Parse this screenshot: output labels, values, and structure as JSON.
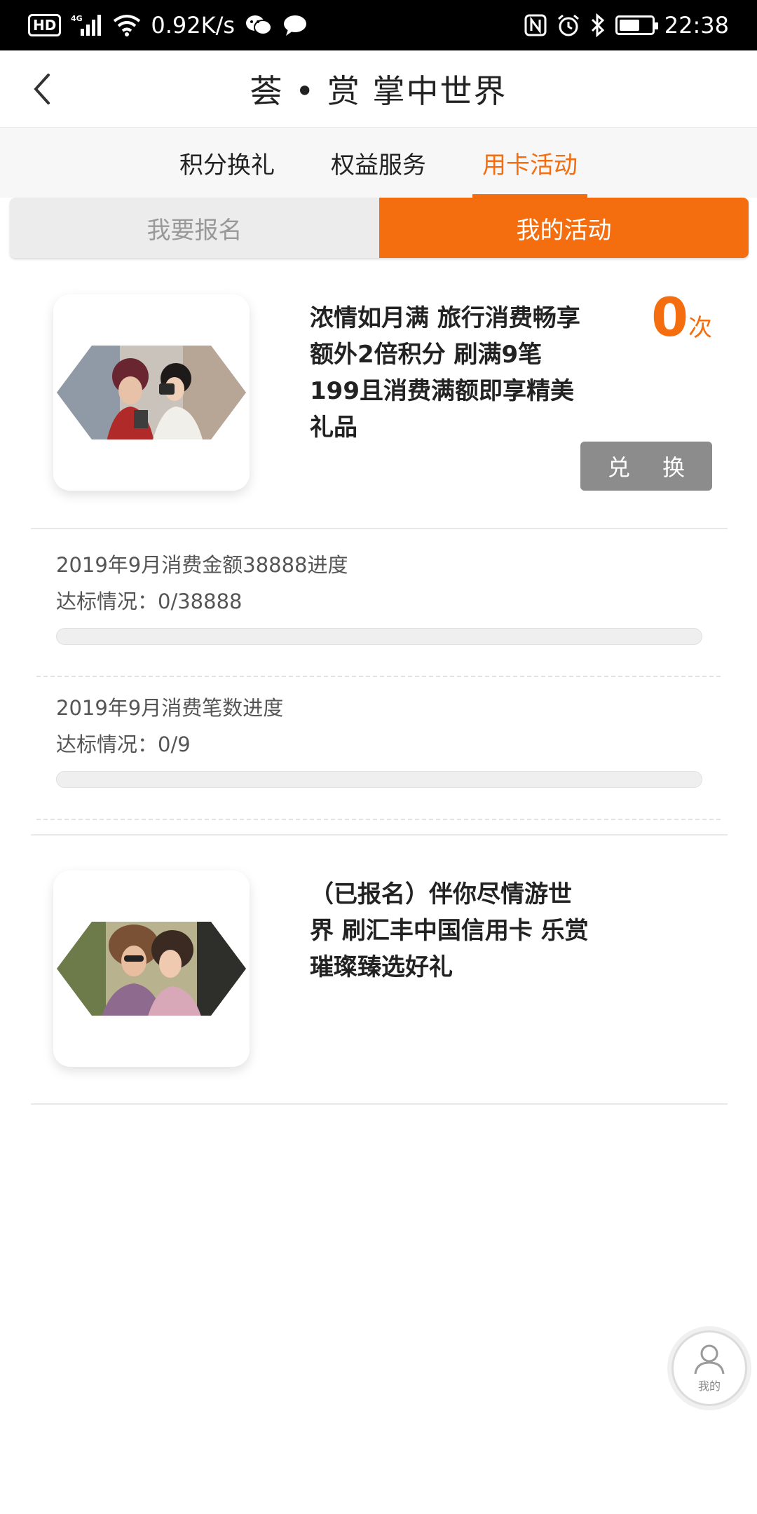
{
  "status_bar": {
    "hd": "HD",
    "network": "4G",
    "speed": "0.92K/s",
    "time": "22:38",
    "battery_level": 0.65
  },
  "header": {
    "title": "荟 • 赏 掌中世界"
  },
  "tabs": [
    {
      "label": "积分换礼",
      "active": false
    },
    {
      "label": "权益服务",
      "active": false
    },
    {
      "label": "用卡活动",
      "active": true
    }
  ],
  "segment": {
    "left": "我要报名",
    "right": "我的活动",
    "selected": "right"
  },
  "activities": [
    {
      "title": "浓情如月满 旅行消费畅享额外2倍积分 刷满9笔199且消费满额即享精美礼品",
      "count": "0",
      "count_unit": "次",
      "redeem_label": "兑 换",
      "progress": [
        {
          "label": "2019年9月消费金额38888进度",
          "status": "达标情况：0/38888",
          "value": 0
        },
        {
          "label": "2019年9月消费笔数进度",
          "status": "达标情况：0/9",
          "value": 0
        }
      ]
    },
    {
      "title": "（已报名）伴你尽情游世界 刷汇丰中国信用卡 乐赏璀璨臻选好礼"
    }
  ],
  "fab": {
    "label": "我的"
  },
  "colors": {
    "accent": "#f46e0f",
    "button_gray": "#8c8c8c"
  }
}
